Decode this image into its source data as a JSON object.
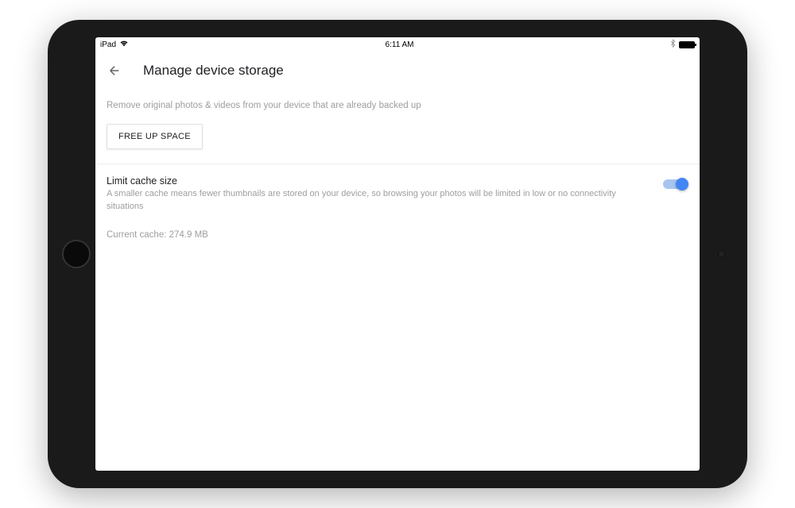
{
  "status_bar": {
    "device_label": "iPad",
    "time": "6:11 AM"
  },
  "header": {
    "title": "Manage device storage"
  },
  "free_up": {
    "description": "Remove original photos & videos from your device that are already backed up",
    "button_label": "FREE UP SPACE"
  },
  "limit_cache": {
    "title": "Limit cache size",
    "description": "A smaller cache means fewer thumbnails are stored on your device, so browsing your photos will be limited in low or no connectivity situations",
    "current_cache_label": "Current cache: 274.9 MB",
    "toggle_on": true
  }
}
